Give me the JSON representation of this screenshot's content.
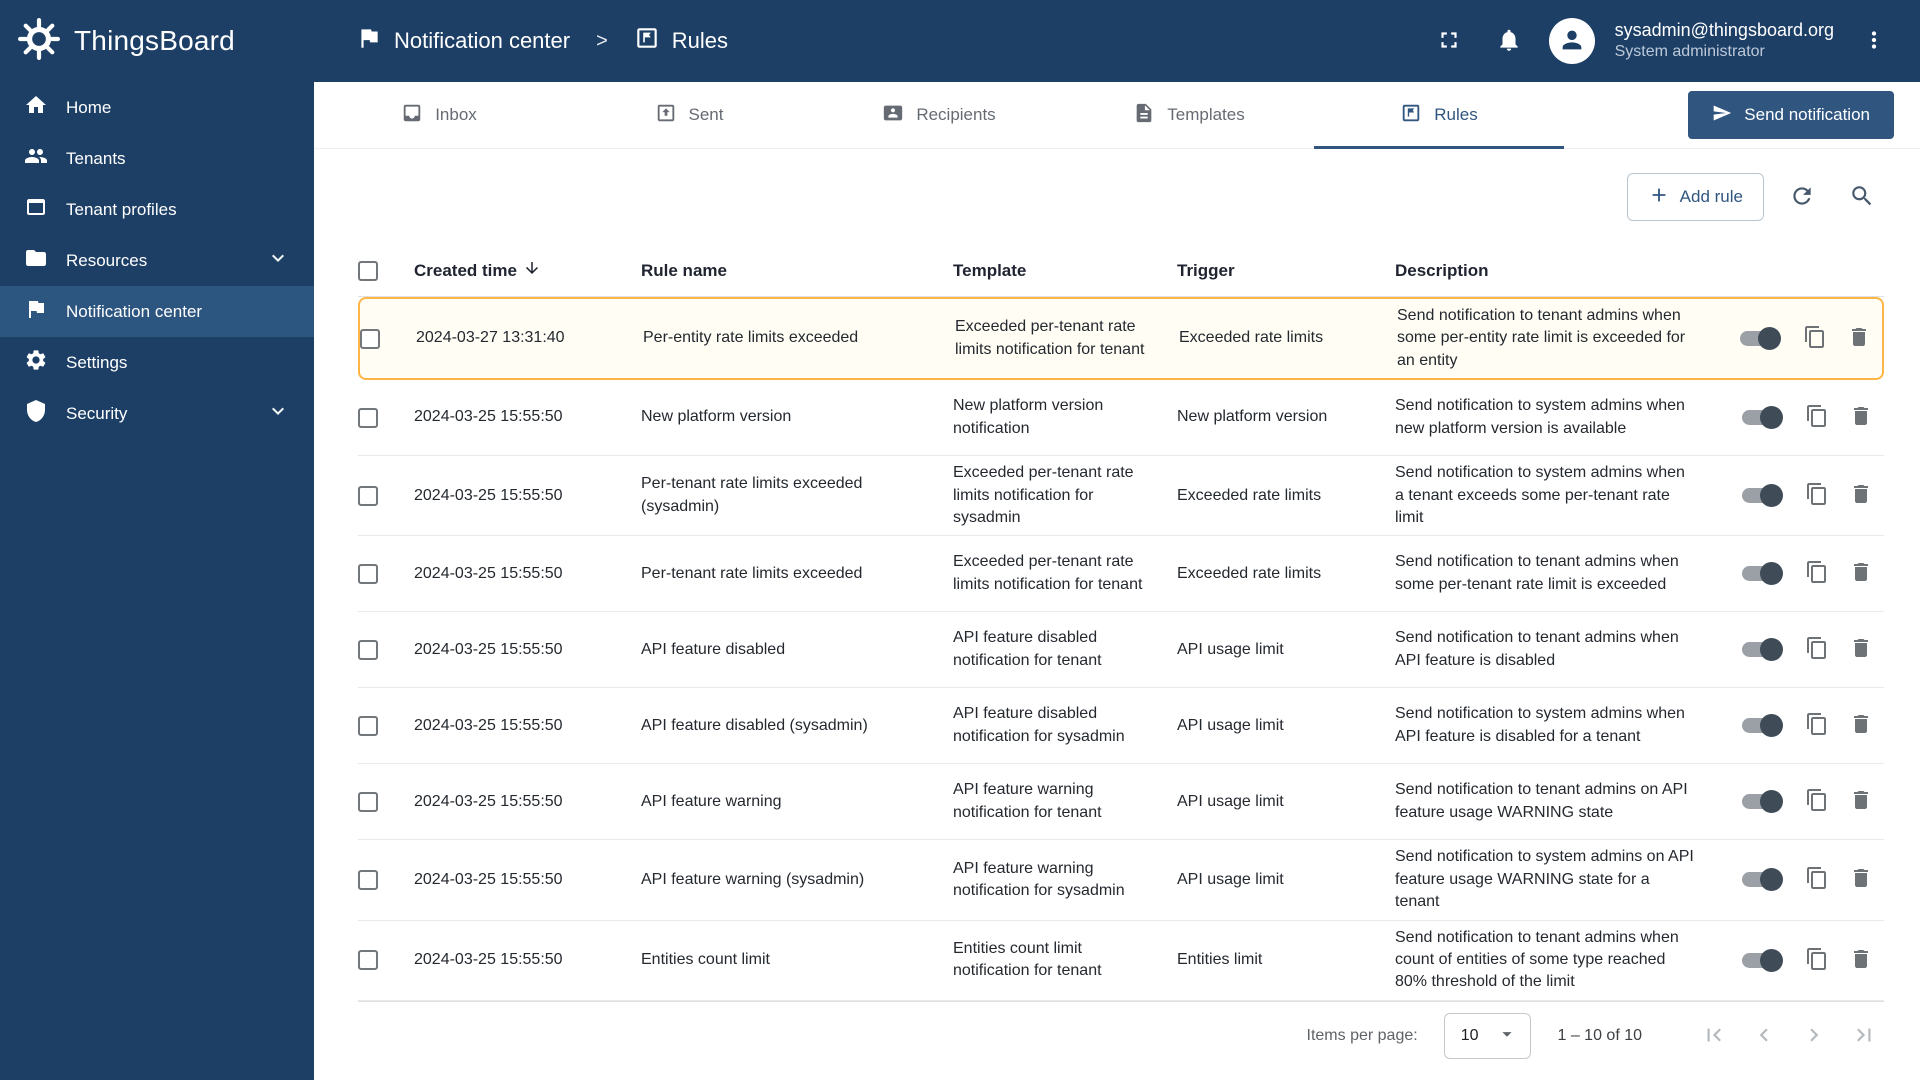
{
  "app": {
    "title": "ThingsBoard"
  },
  "colors": {
    "primary": "#305680",
    "sidebar_bg": "#1d3f66",
    "sidebar_active_bg": "#2c5580",
    "highlight_border": "#ffb546"
  },
  "header": {
    "breadcrumb": [
      {
        "label": "Notification center"
      },
      {
        "label": "Rules"
      }
    ],
    "user": {
      "email": "sysadmin@thingsboard.org",
      "role": "System administrator"
    }
  },
  "sidebar": {
    "items": [
      {
        "label": "Home"
      },
      {
        "label": "Tenants"
      },
      {
        "label": "Tenant profiles"
      },
      {
        "label": "Resources"
      },
      {
        "label": "Notification center"
      },
      {
        "label": "Settings"
      },
      {
        "label": "Security"
      }
    ]
  },
  "tabs": [
    {
      "label": "Inbox"
    },
    {
      "label": "Sent"
    },
    {
      "label": "Recipients"
    },
    {
      "label": "Templates"
    },
    {
      "label": "Rules"
    }
  ],
  "actions": {
    "send_notification": "Send notification",
    "add_rule": "Add rule"
  },
  "table": {
    "headers": {
      "created": "Created time",
      "rule": "Rule name",
      "template": "Template",
      "trigger": "Trigger",
      "description": "Description"
    },
    "rows": [
      {
        "created": "2024-03-27 13:31:40",
        "rule_name": "Per-entity rate limits exceeded",
        "template": "Exceeded per-tenant rate limits notification for tenant",
        "trigger": "Exceeded rate limits",
        "description": "Send notification to tenant admins when some per-entity rate limit is exceeded for an entity",
        "highlighted": true
      },
      {
        "created": "2024-03-25 15:55:50",
        "rule_name": "New platform version",
        "template": "New platform version notification",
        "trigger": "New platform version",
        "description": "Send notification to system admins when new platform version is available",
        "highlighted": false
      },
      {
        "created": "2024-03-25 15:55:50",
        "rule_name": "Per-tenant rate limits exceeded (sysadmin)",
        "template": "Exceeded per-tenant rate limits notification for sysadmin",
        "trigger": "Exceeded rate limits",
        "description": "Send notification to system admins when a tenant exceeds some per-tenant rate limit",
        "highlighted": false
      },
      {
        "created": "2024-03-25 15:55:50",
        "rule_name": "Per-tenant rate limits exceeded",
        "template": "Exceeded per-tenant rate limits notification for tenant",
        "trigger": "Exceeded rate limits",
        "description": "Send notification to tenant admins when some per-tenant rate limit is exceeded",
        "highlighted": false
      },
      {
        "created": "2024-03-25 15:55:50",
        "rule_name": "API feature disabled",
        "template": "API feature disabled notification for tenant",
        "trigger": "API usage limit",
        "description": "Send notification to tenant admins when API feature is disabled",
        "highlighted": false
      },
      {
        "created": "2024-03-25 15:55:50",
        "rule_name": "API feature disabled (sysadmin)",
        "template": "API feature disabled notification for sysadmin",
        "trigger": "API usage limit",
        "description": "Send notification to system admins when API feature is disabled for a tenant",
        "highlighted": false
      },
      {
        "created": "2024-03-25 15:55:50",
        "rule_name": "API feature warning",
        "template": "API feature warning notification for tenant",
        "trigger": "API usage limit",
        "description": "Send notification to tenant admins on API feature usage WARNING state",
        "highlighted": false
      },
      {
        "created": "2024-03-25 15:55:50",
        "rule_name": "API feature warning (sysadmin)",
        "template": "API feature warning notification for sysadmin",
        "trigger": "API usage limit",
        "description": "Send notification to system admins on API feature usage WARNING state for a tenant",
        "highlighted": false
      },
      {
        "created": "2024-03-25 15:55:50",
        "rule_name": "Entities count limit",
        "template": "Entities count limit notification for tenant",
        "trigger": "Entities limit",
        "description": "Send notification to tenant admins when count of entities of some type reached 80% threshold of the limit",
        "highlighted": false
      }
    ]
  },
  "pagination": {
    "items_per_page_label": "Items per page:",
    "page_size": "10",
    "range": "1 – 10 of 10"
  }
}
